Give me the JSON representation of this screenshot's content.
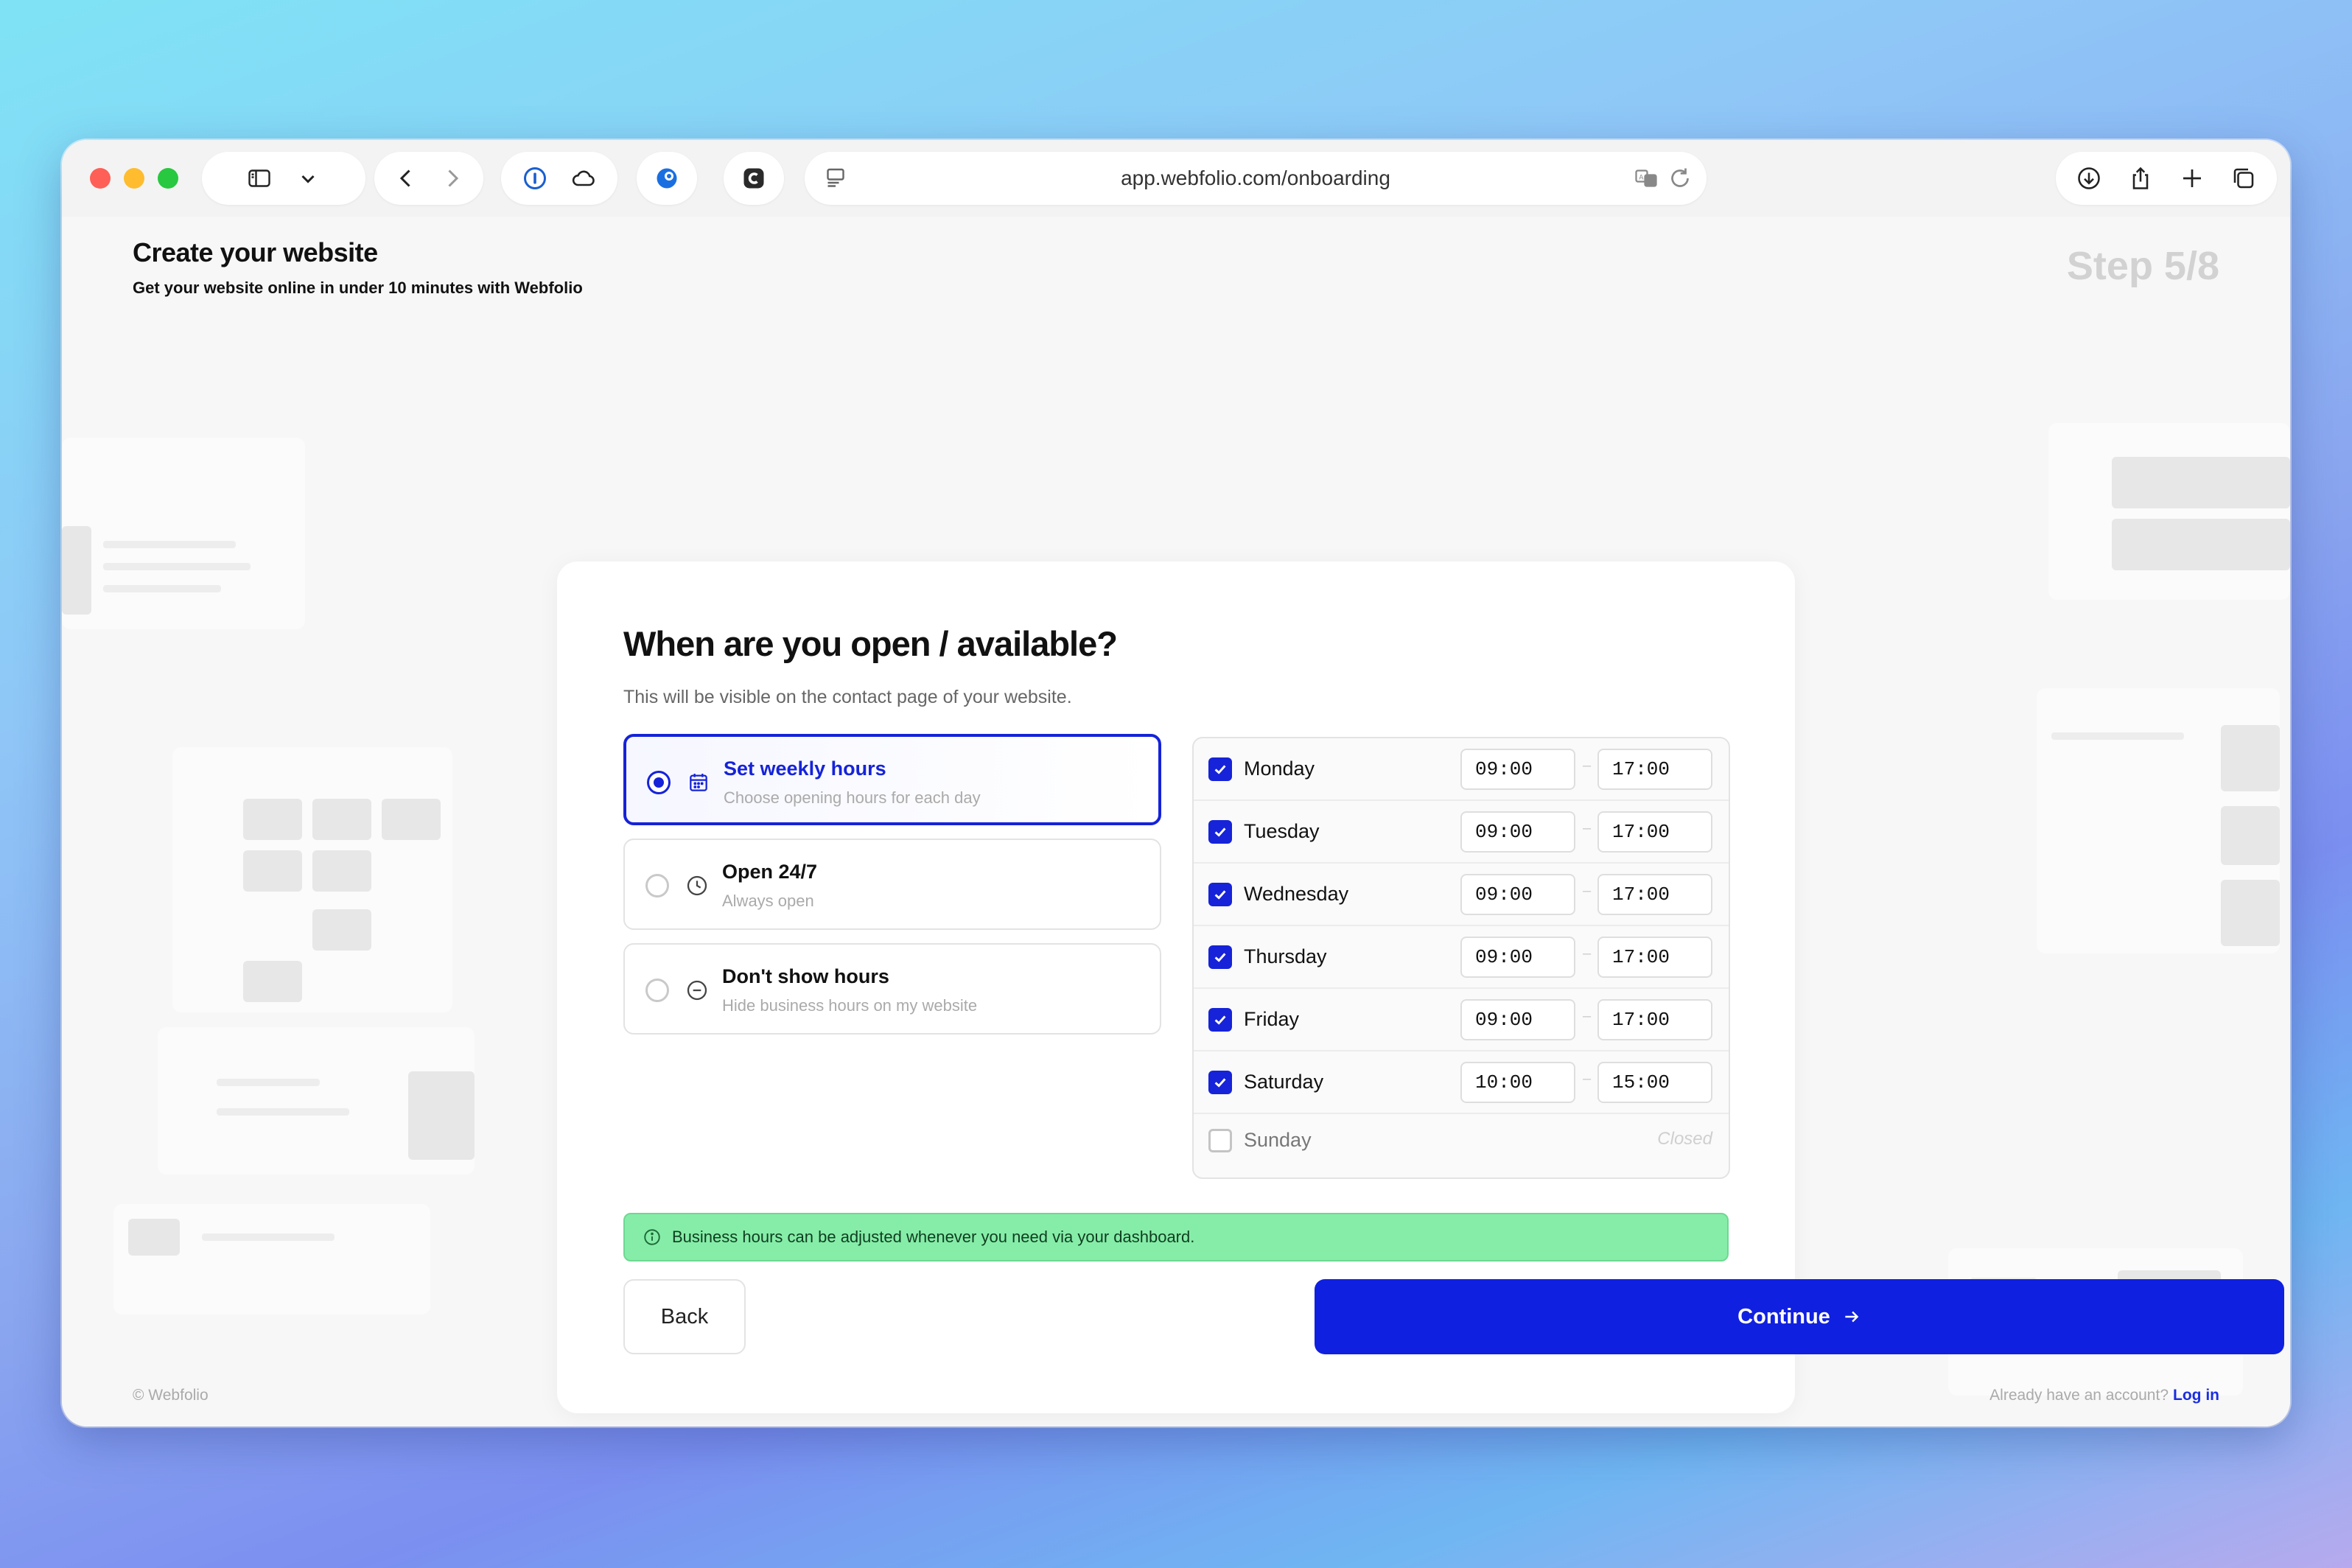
{
  "browser": {
    "url": "app.webfolio.com/onboarding"
  },
  "header": {
    "title": "Create your website",
    "subtitle": "Get your website online in under 10 minutes with Webfolio",
    "step": "Step 5/8"
  },
  "form": {
    "title": "When are you open / available?",
    "lead": "This will be visible on the contact page of your website.",
    "options": [
      {
        "title": "Set weekly hours",
        "description": "Choose opening hours for each day",
        "selected": true,
        "icon": "calendar-icon"
      },
      {
        "title": "Open 24/7",
        "description": "Always open",
        "selected": false,
        "icon": "clock-icon"
      },
      {
        "title": "Don't show hours",
        "description": "Hide business hours on my website",
        "selected": false,
        "icon": "minus-circle-icon"
      }
    ],
    "schedule": [
      {
        "day": "Monday",
        "checked": true,
        "open": "09:00",
        "close": "17:00"
      },
      {
        "day": "Tuesday",
        "checked": true,
        "open": "09:00",
        "close": "17:00"
      },
      {
        "day": "Wednesday",
        "checked": true,
        "open": "09:00",
        "close": "17:00"
      },
      {
        "day": "Thursday",
        "checked": true,
        "open": "09:00",
        "close": "17:00"
      },
      {
        "day": "Friday",
        "checked": true,
        "open": "09:00",
        "close": "17:00"
      },
      {
        "day": "Saturday",
        "checked": true,
        "open": "10:00",
        "close": "15:00"
      },
      {
        "day": "Sunday",
        "checked": false,
        "closed_label": "Closed"
      }
    ],
    "notice": "Business hours can be adjusted whenever you need via your dashboard.",
    "back_label": "Back",
    "continue_label": "Continue"
  },
  "footer": {
    "copyright": "© Webfolio",
    "account_prompt": "Already have an account?",
    "login_label": "Log in"
  },
  "colors": {
    "accent": "#1623d8",
    "notice_bg": "#86eda8"
  }
}
